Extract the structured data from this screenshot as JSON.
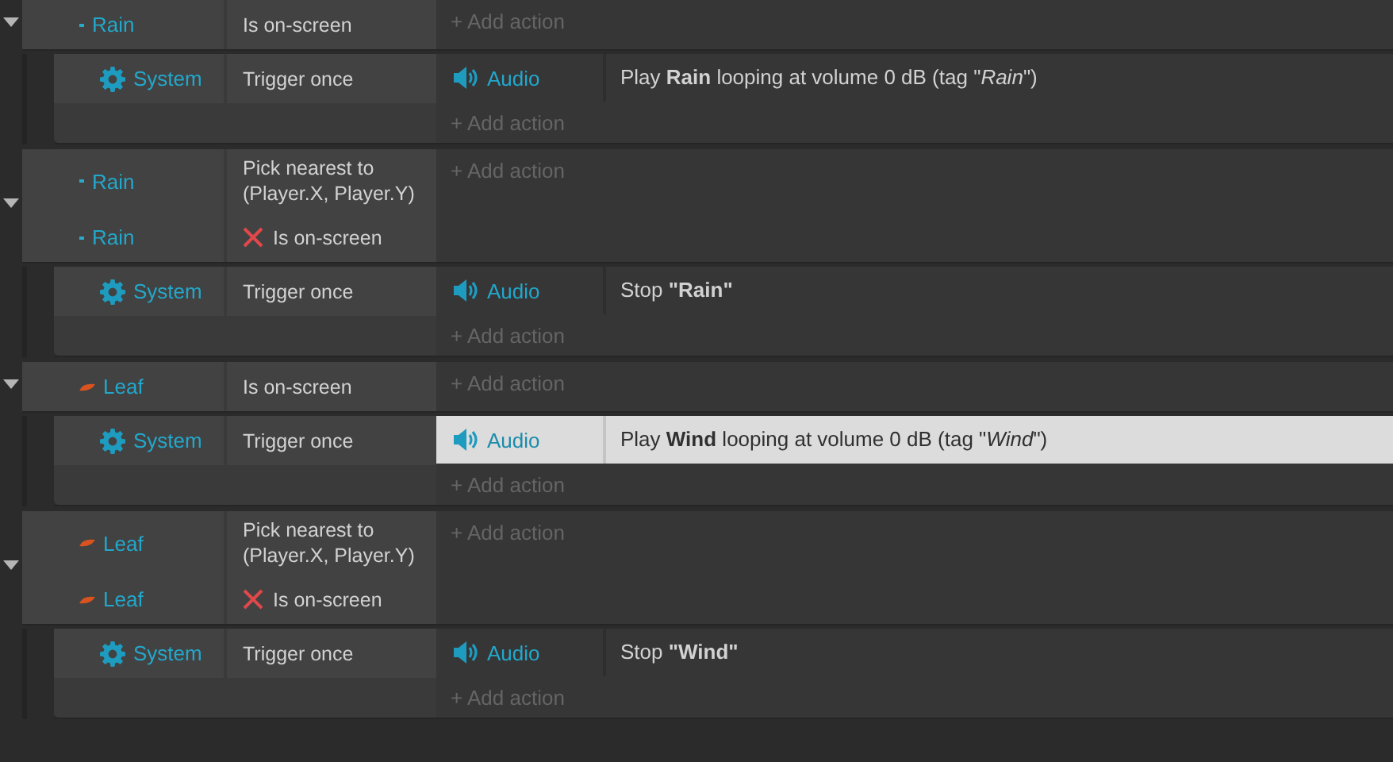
{
  "events": [
    {
      "expanded": true,
      "conditions": [
        {
          "kind": "dot",
          "object": "Rain",
          "text": "Is on-screen",
          "inverted": false
        }
      ],
      "add_action": "+ Add action",
      "children": [
        {
          "conditions": [
            {
              "kind": "gear",
              "object": "System",
              "text": "Trigger once",
              "inverted": false
            }
          ],
          "actions": [
            {
              "kind": "speaker",
              "object": "Audio",
              "text": "Play **Rain** looping at volume 0 dB (tag \"*Rain*\")",
              "selected": false
            }
          ],
          "add_action": "+ Add action"
        }
      ]
    },
    {
      "expanded": true,
      "conditions": [
        {
          "kind": "dot",
          "object": "Rain",
          "text": "Pick nearest to (Player.X, Player.Y)",
          "inverted": false
        },
        {
          "kind": "dot",
          "object": "Rain",
          "text": "Is on-screen",
          "inverted": true
        }
      ],
      "add_action": "+ Add action",
      "children": [
        {
          "conditions": [
            {
              "kind": "gear",
              "object": "System",
              "text": "Trigger once",
              "inverted": false
            }
          ],
          "actions": [
            {
              "kind": "speaker",
              "object": "Audio",
              "text": "Stop **\"Rain\"**",
              "selected": false
            }
          ],
          "add_action": "+ Add action"
        }
      ]
    },
    {
      "expanded": true,
      "conditions": [
        {
          "kind": "leaf",
          "object": "Leaf",
          "text": "Is on-screen",
          "inverted": false
        }
      ],
      "add_action": "+ Add action",
      "children": [
        {
          "conditions": [
            {
              "kind": "gear",
              "object": "System",
              "text": "Trigger once",
              "inverted": false
            }
          ],
          "actions": [
            {
              "kind": "speaker",
              "object": "Audio",
              "text": "Play **Wind** looping at volume 0 dB (tag \"*Wind*\")",
              "selected": true
            }
          ],
          "add_action": "+ Add action"
        }
      ]
    },
    {
      "expanded": true,
      "conditions": [
        {
          "kind": "leaf",
          "object": "Leaf",
          "text": "Pick nearest to (Player.X, Player.Y)",
          "inverted": false
        },
        {
          "kind": "leaf",
          "object": "Leaf",
          "text": "Is on-screen",
          "inverted": true
        }
      ],
      "add_action": "+ Add action",
      "children": [
        {
          "conditions": [
            {
              "kind": "gear",
              "object": "System",
              "text": "Trigger once",
              "inverted": false
            }
          ],
          "actions": [
            {
              "kind": "speaker",
              "object": "Audio",
              "text": "Stop **\"Wind\"**",
              "selected": false
            }
          ],
          "add_action": "+ Add action"
        }
      ]
    }
  ]
}
